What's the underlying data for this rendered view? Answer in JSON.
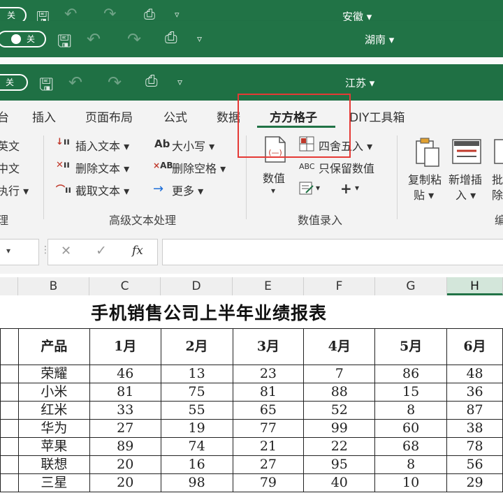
{
  "windows": {
    "back": {
      "toggle": "关",
      "region": "安徽"
    },
    "middle": {
      "toggle": "关",
      "region": "湖南"
    },
    "front": {
      "toggle": "关",
      "region": "江苏"
    }
  },
  "ribbon_tabs": [
    "台",
    "插入",
    "页面布局",
    "公式",
    "数据",
    "方方格子",
    "DIY工具箱"
  ],
  "ribbon": {
    "left_cut": [
      "英文",
      "中文",
      "执行"
    ],
    "text_tools": {
      "insert_text": "插入文本",
      "delete_text": "删除文本",
      "cut_text": "截取文本",
      "case": "大小写",
      "delete_spaces": "删除空格",
      "more": "更多",
      "group": "高级文本处理"
    },
    "value_entry": {
      "number": "数值",
      "round": "四舍五入",
      "keep_number": "只保留数值",
      "plus": "+",
      "group": "数值录入"
    },
    "right": {
      "copy_paste": [
        "复制粘",
        "贴"
      ],
      "add_insert": [
        "新增插",
        "入"
      ],
      "batch": [
        "批",
        "除"
      ],
      "group_cut": "编"
    },
    "left_group_cut": "理"
  },
  "formula_bar": {
    "fx": "fx",
    "cancel": "✕",
    "enter": "✓"
  },
  "columns": [
    "B",
    "C",
    "D",
    "E",
    "F",
    "G",
    "H"
  ],
  "sheet": {
    "title": "手机销售公司上半年业绩报表",
    "headers": [
      "产品",
      "1月",
      "2月",
      "3月",
      "4月",
      "5月",
      "6月"
    ],
    "rows": [
      [
        "荣耀",
        "46",
        "13",
        "23",
        "7",
        "86",
        "48"
      ],
      [
        "小米",
        "81",
        "75",
        "81",
        "88",
        "15",
        "36"
      ],
      [
        "红米",
        "33",
        "55",
        "65",
        "52",
        "8",
        "87"
      ],
      [
        "华为",
        "27",
        "19",
        "77",
        "99",
        "60",
        "38"
      ],
      [
        "苹果",
        "89",
        "74",
        "21",
        "22",
        "68",
        "78"
      ],
      [
        "联想",
        "20",
        "16",
        "27",
        "95",
        "8",
        "56"
      ],
      [
        "三星",
        "20",
        "98",
        "79",
        "40",
        "10",
        "29"
      ]
    ]
  }
}
